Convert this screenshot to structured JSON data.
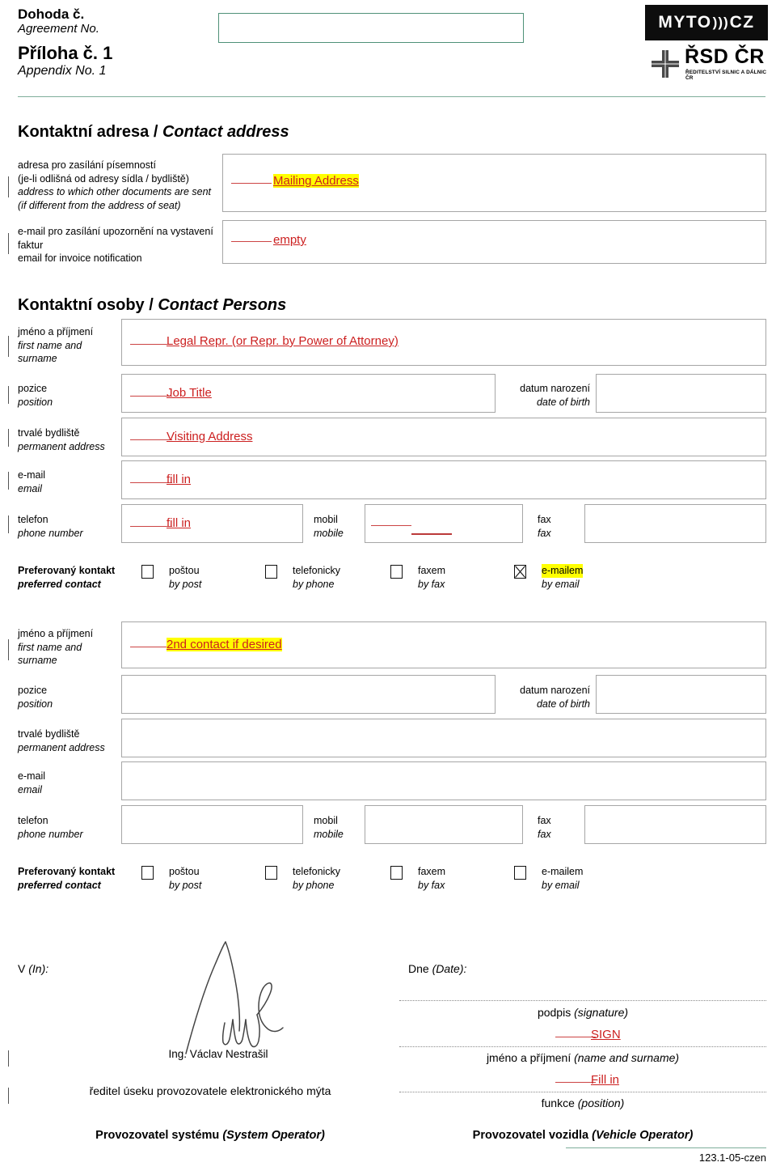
{
  "header": {
    "agreement_cs": "Dohoda č.",
    "agreement_en": "Agreement No.",
    "appendix_cs": "Příloha č. 1",
    "appendix_en": "Appendix No. 1",
    "logo_myto": "MYTO",
    "logo_myto_suffix": "CZ",
    "logo_rsd": "ŘSD ČR",
    "logo_rsd_sub": "ŘEDITELSTVÍ SILNIC A DÁLNIC ČR",
    "rule_color": "#7fae9b",
    "agreement_box_border": "#4f9178"
  },
  "contact_address": {
    "heading_cs": "Kontaktní adresa",
    "heading_sep": " / ",
    "heading_en": "Contact address",
    "rows": [
      {
        "label_lines": [
          "adresa pro zasílání písemností",
          "(je-li odlišná od adresy sídla / bydliště)"
        ],
        "label_italic_lines": [
          "address to which other documents are sent",
          "(if different from the address of seat)"
        ],
        "annotation": "Mailing Address",
        "highlight": true
      },
      {
        "label_lines": [
          "e-mail pro zasílání upozornění na vystavení",
          "faktur"
        ],
        "label_italic_lines": [
          "email for invoice notification"
        ],
        "annotation": "empty",
        "highlight": false
      }
    ]
  },
  "contact_persons": {
    "heading_cs": "Kontaktní osoby",
    "heading_sep": " / ",
    "heading_en": "Contact Persons",
    "labels": {
      "name_cs": "jméno a příjmení",
      "name_en_1": "first name and",
      "name_en_2": "surname",
      "position_cs": "pozice",
      "position_en": "position",
      "address_cs": "trvalé bydliště",
      "address_en": "permanent address",
      "email_cs": "e-mail",
      "email_en": "email",
      "phone_cs": "telefon",
      "phone_en": "phone number",
      "mobile_cs": "mobil",
      "mobile_en": "mobile",
      "fax_cs": "fax",
      "fax_en": "fax",
      "dob_cs": "datum narození",
      "dob_en": "date of birth",
      "pref_cs": "Preferovaný kontakt",
      "pref_en": "preferred contact"
    },
    "preferred_options": [
      {
        "cs": "poštou",
        "en": "by post",
        "checked": false,
        "highlight": false
      },
      {
        "cs": "telefonicky",
        "en": "by phone",
        "checked": false,
        "highlight": false
      },
      {
        "cs": "faxem",
        "en": "by fax",
        "checked": false,
        "highlight": false
      },
      {
        "cs": "e-mailem",
        "en": "by email",
        "checked": true,
        "highlight": true
      }
    ],
    "preferred_options_2": [
      {
        "cs": "poštou",
        "en": "by post",
        "checked": false,
        "highlight": false
      },
      {
        "cs": "telefonicky",
        "en": "by phone",
        "checked": false,
        "highlight": false
      },
      {
        "cs": "faxem",
        "en": "by fax",
        "checked": false,
        "highlight": false
      },
      {
        "cs": "e-mailem",
        "en": "by email",
        "checked": false,
        "highlight": false
      }
    ],
    "person1_annotations": {
      "name": "Legal Repr. (or Repr. by Power of Attorney)",
      "position": "Job Title",
      "address": "Visiting Address",
      "email": "fill in",
      "phone": "fill in",
      "mobile": ""
    },
    "person2_annotations": {
      "name": "2nd contact if desired"
    }
  },
  "signature": {
    "place_cs": "V",
    "place_en": "(In):",
    "date_cs": "Dne",
    "date_en": "(Date):",
    "operator_name": "Ing. Václav Nestrašil",
    "operator_title": "ředitel úseku provozovatele elektronického mýta",
    "operator_role_cs": "Provozovatel systému",
    "operator_role_en": "(System Operator)",
    "vehicle_lines": [
      {
        "cs": "podpis",
        "en": "(signature)"
      },
      {
        "cs": "jméno a příjmení",
        "en": "(name and surname)"
      },
      {
        "cs": "funkce",
        "en": "(position)"
      }
    ],
    "vehicle_role_cs": "Provozovatel vozidla",
    "vehicle_role_en": "(Vehicle Operator)",
    "annotation_sign": "SIGN",
    "annotation_fill": "Fill in"
  },
  "footer": {
    "code": "123.1-05-czen"
  },
  "colors": {
    "annotation_red": "#cc2020",
    "highlight_yellow": "#ffff00",
    "box_border": "#a6a6a6",
    "rule_green": "#7fae9b"
  }
}
